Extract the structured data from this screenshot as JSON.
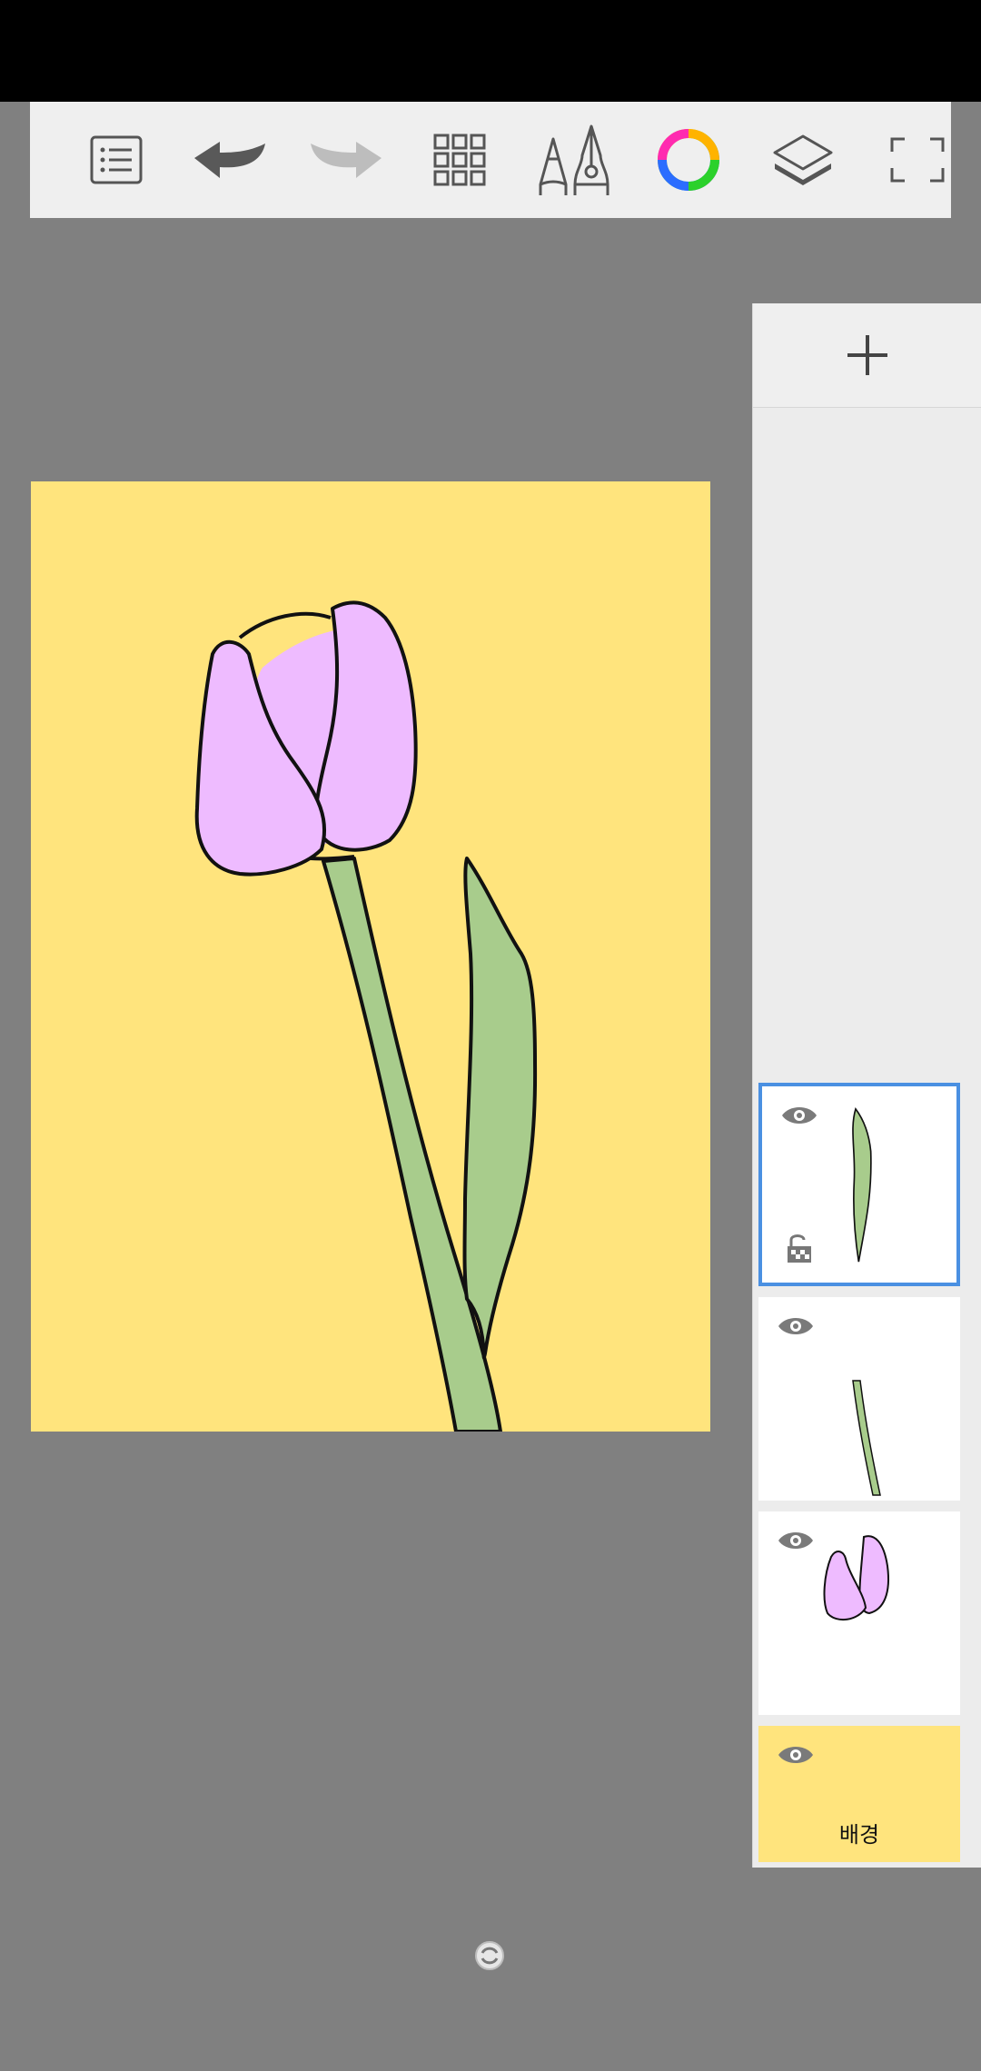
{
  "toolbar": {
    "buttons": [
      {
        "name": "menu-list-icon"
      },
      {
        "name": "undo-icon"
      },
      {
        "name": "redo-icon"
      },
      {
        "name": "grid-icon"
      },
      {
        "name": "brush-tools-icon"
      },
      {
        "name": "color-wheel-icon"
      },
      {
        "name": "layers-icon"
      },
      {
        "name": "fullscreen-icon"
      }
    ]
  },
  "layers": {
    "add_icon": "plus-icon",
    "items": [
      {
        "content": "leaf",
        "selected": true,
        "lock_icon": "lock-open-icon"
      },
      {
        "content": "stem",
        "selected": false
      },
      {
        "content": "flower",
        "selected": false
      },
      {
        "content": "background",
        "selected": false,
        "name": "배경"
      }
    ]
  },
  "canvas": {
    "background_color": "#ffe47d",
    "petal_color": "#eebbff",
    "leaf_color": "#a8cc8c"
  }
}
